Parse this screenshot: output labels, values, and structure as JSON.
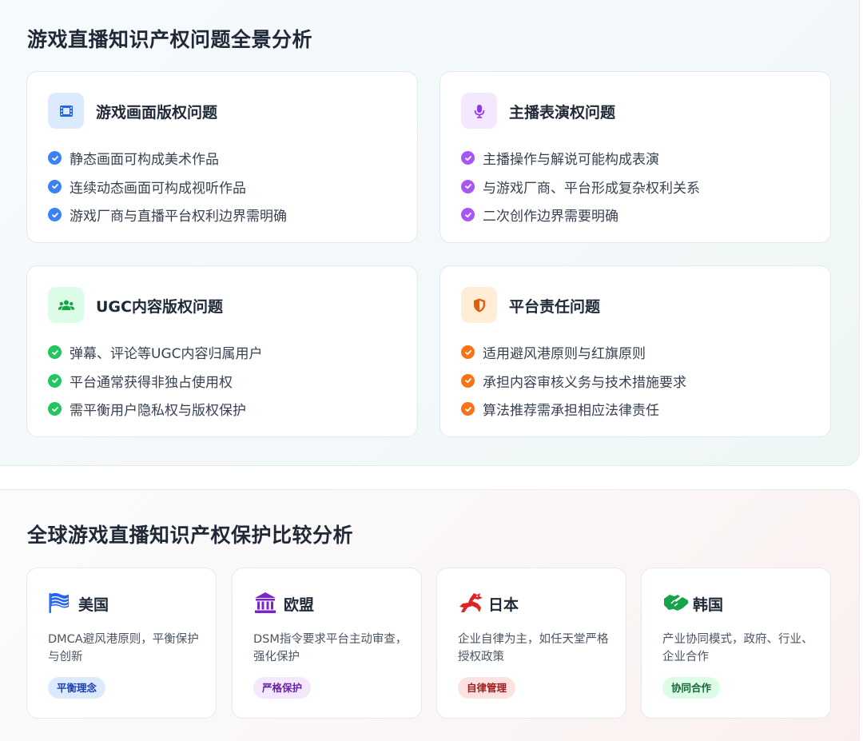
{
  "section1": {
    "title": "游戏直播知识产权问题全景分析",
    "cards": [
      {
        "title": "游戏画面版权问题",
        "icon": "film-icon",
        "color": "#3b82f6",
        "items": [
          "静态画面可构成美术作品",
          "连续动态画面可构成视听作品",
          "游戏厂商与直播平台权利边界需明确"
        ]
      },
      {
        "title": "主播表演权问题",
        "icon": "microphone-icon",
        "color": "#a855f7",
        "items": [
          "主播操作与解说可能构成表演",
          "与游戏厂商、平台形成复杂权利关系",
          "二次创作边界需要明确"
        ]
      },
      {
        "title": "UGC内容版权问题",
        "icon": "users-icon",
        "color": "#22c55e",
        "items": [
          "弹幕、评论等UGC内容归属用户",
          "平台通常获得非独占使用权",
          "需平衡用户隐私权与版权保护"
        ]
      },
      {
        "title": "平台责任问题",
        "icon": "shield-icon",
        "color": "#f97316",
        "items": [
          "适用避风港原则与红旗原则",
          "承担内容审核义务与技术措施要求",
          "算法推荐需承担相应法律责任"
        ]
      }
    ]
  },
  "section2": {
    "title": "全球游戏直播知识产权保护比较分析",
    "countries": [
      {
        "name": "美国",
        "icon": "flag-usa-icon",
        "desc": "DMCA避风港原则，平衡保护与创新",
        "tag": "平衡理念",
        "color": "#2563eb"
      },
      {
        "name": "欧盟",
        "icon": "landmark-icon",
        "desc": "DSM指令要求平台主动审查，强化保护",
        "tag": "严格保护",
        "color": "#7e22ce"
      },
      {
        "name": "日本",
        "icon": "dragon-icon",
        "desc": "企业自律为主，如任天堂严格授权政策",
        "tag": "自律管理",
        "color": "#dc2626"
      },
      {
        "name": "韩国",
        "icon": "handshake-icon",
        "desc": "产业协同模式，政府、行业、企业合作",
        "tag": "协同合作",
        "color": "#16a34a"
      }
    ]
  }
}
